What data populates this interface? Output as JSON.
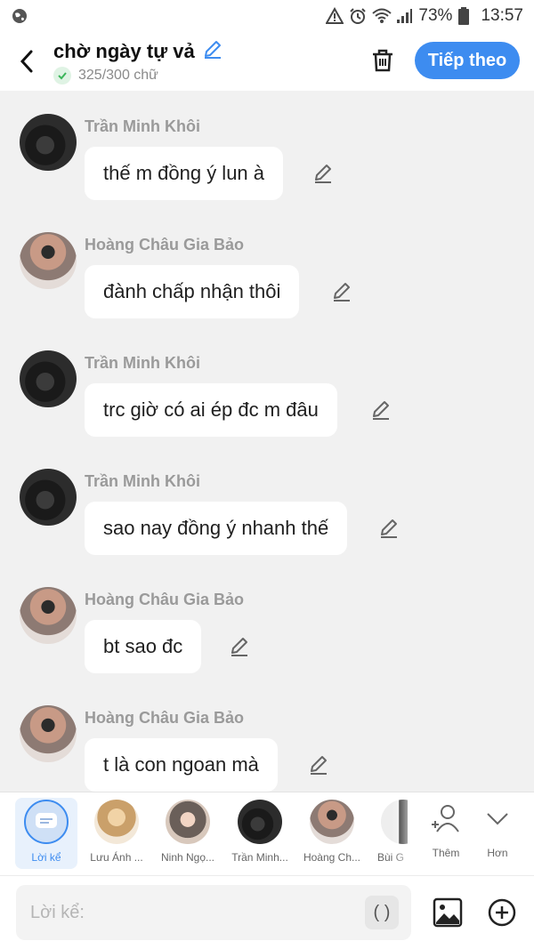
{
  "status_bar": {
    "battery_percent": "73%",
    "time": "13:57",
    "icons": [
      "globe-icon",
      "alert-icon",
      "alarm-icon",
      "wifi-icon",
      "signal-icon",
      "battery-icon"
    ]
  },
  "header": {
    "title": "chờ ngày tự vả",
    "char_count": "325/300 chữ",
    "next_label": "Tiếp theo",
    "accent_color": "#3d8cf0"
  },
  "messages": [
    {
      "sender": "Trần Minh Khôi",
      "text": "thế m đồng ý lun à"
    },
    {
      "sender": "Hoàng Châu Gia Bảo",
      "text": "đành chấp nhận thôi"
    },
    {
      "sender": "Trần Minh Khôi",
      "text": "trc giờ có ai ép đc m đâu"
    },
    {
      "sender": "Trần Minh Khôi",
      "text": "sao nay đồng ý nhanh thế"
    },
    {
      "sender": "Hoàng Châu Gia Bảo",
      "text": "bt sao đc"
    },
    {
      "sender": "Hoàng Châu Gia Bảo",
      "text": "t là con ngoan mà"
    }
  ],
  "characters": [
    {
      "label": "Lời kể",
      "selected": true
    },
    {
      "label": "Lưu Ánh ..."
    },
    {
      "label": "Ninh Ngọ..."
    },
    {
      "label": "Trần Minh..."
    },
    {
      "label": "Hoàng Ch..."
    },
    {
      "label": "Bùi G"
    }
  ],
  "tools": {
    "add_label": "Thêm",
    "more_label": "Hơn"
  },
  "input": {
    "placeholder": "Lời kể:",
    "paren_label": "( )"
  }
}
